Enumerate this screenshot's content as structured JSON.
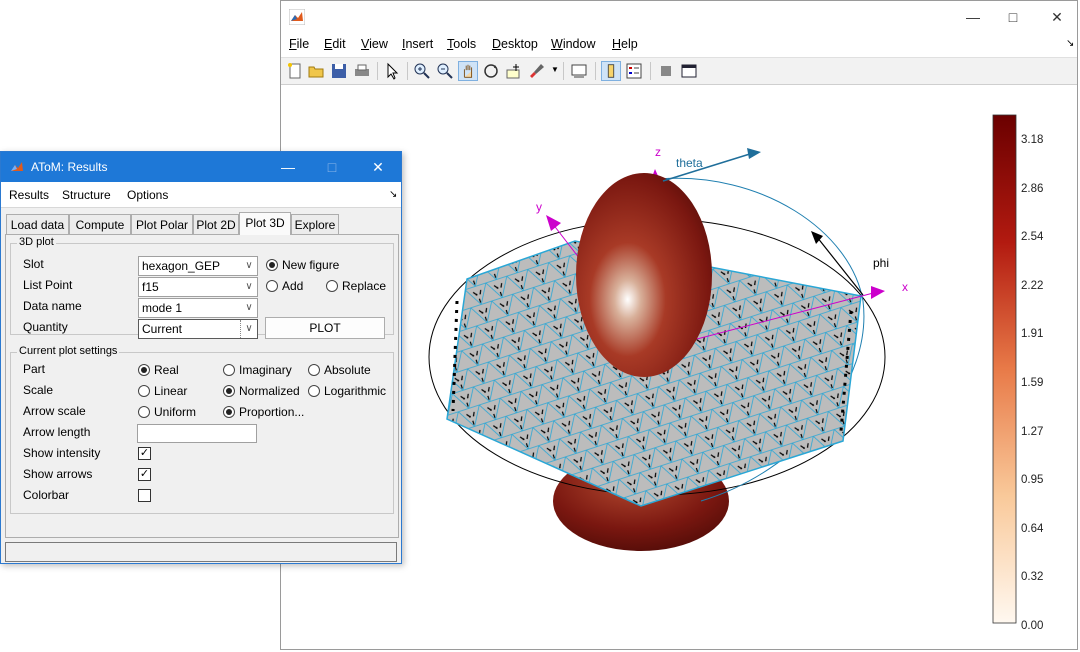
{
  "figure": {
    "menu": [
      {
        "label": "File",
        "key": "F",
        "rest": "ile"
      },
      {
        "label": "Edit",
        "key": "E",
        "rest": "dit"
      },
      {
        "label": "View",
        "key": "V",
        "rest": "iew"
      },
      {
        "label": "Insert",
        "key": "I",
        "rest": "nsert"
      },
      {
        "label": "Tools",
        "key": "T",
        "rest": "ools"
      },
      {
        "label": "Desktop",
        "key": "D",
        "rest": "esktop"
      },
      {
        "label": "Window",
        "key": "W",
        "rest": "indow"
      },
      {
        "label": "Help",
        "key": "H",
        "rest": "elp"
      }
    ],
    "toolbar_icons": [
      "new-figure-icon",
      "open-file-icon",
      "save-icon",
      "print-icon",
      "pointer-icon",
      "zoom-in-icon",
      "zoom-out-icon",
      "pan-icon",
      "rotate-3d-icon",
      "data-cursor-icon",
      "brush-icon",
      "link-plot-icon",
      "colorbar-icon",
      "legend-icon",
      "hide-tools-icon",
      "dock-icon"
    ],
    "axis_labels": {
      "x": "x",
      "y": "y",
      "z": "z",
      "theta": "theta",
      "phi": "phi"
    },
    "colorbar": {
      "ticks": [
        "3.18",
        "2.86",
        "2.54",
        "2.22",
        "1.91",
        "1.59",
        "1.27",
        "0.95",
        "0.64",
        "0.32",
        "0.00"
      ],
      "colors": {
        "top": "#6b0000",
        "mid": "#d44a2a",
        "low": "#f6c28f",
        "bottom": "#fff8f0"
      }
    },
    "colors": {
      "surface": "#bcbcbc",
      "mesh": "#2aa7d6",
      "axis_magenta": "#cc00cc",
      "theta_blue": "#1f6e9a",
      "lobe": "#8a1a12"
    }
  },
  "dialog": {
    "title": "AToM: Results",
    "menu": [
      "Results",
      "Structure",
      "Options"
    ],
    "tabs": [
      "Load data",
      "Compute",
      "Plot Polar",
      "Plot 2D",
      "Plot 3D",
      "Explore"
    ],
    "active_tab": "Plot 3D",
    "plot3d": {
      "group_title": "3D plot",
      "slot_label": "Slot",
      "slot_value": "hexagon_GEP",
      "listpoint_label": "List Point",
      "listpoint_value": "f15",
      "dataname_label": "Data name",
      "dataname_value": "mode 1",
      "quantity_label": "Quantity",
      "quantity_value": "Current",
      "new_figure": "New figure",
      "add": "Add",
      "replace": "Replace",
      "plot_button": "PLOT"
    },
    "settings": {
      "group_title": "Current plot settings",
      "part_label": "Part",
      "part_options": [
        "Real",
        "Imaginary",
        "Absolute"
      ],
      "scale_label": "Scale",
      "scale_options": [
        "Linear",
        "Normalized",
        "Logarithmic"
      ],
      "arrowscale_label": "Arrow scale",
      "arrowscale_options": [
        "Uniform",
        "Proportion..."
      ],
      "arrowlength_label": "Arrow length",
      "showintensity_label": "Show intensity",
      "showarrows_label": "Show arrows",
      "colorbar_label": "Colorbar"
    }
  }
}
